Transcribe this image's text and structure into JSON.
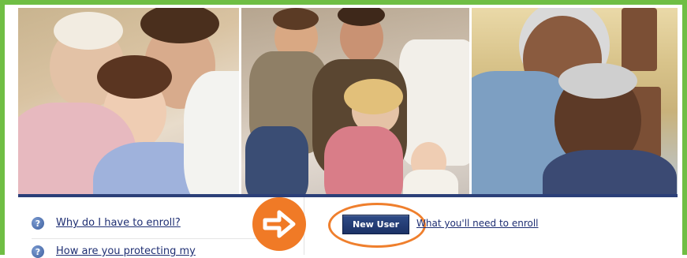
{
  "faq": [
    {
      "label": "Why do I have to enroll?",
      "icon": "question-icon"
    },
    {
      "label": "How are you protecting my",
      "icon": "question-icon"
    }
  ],
  "new_user_button": {
    "label": "New User"
  },
  "enroll_link": {
    "label": "What you'll need to enroll"
  },
  "arrow_icon": "right-arrow-icon",
  "colors": {
    "frame": "#6fbe44",
    "accent_orange": "#f07a26",
    "brand_navy": "#2b3f78",
    "link": "#1f2f73"
  }
}
